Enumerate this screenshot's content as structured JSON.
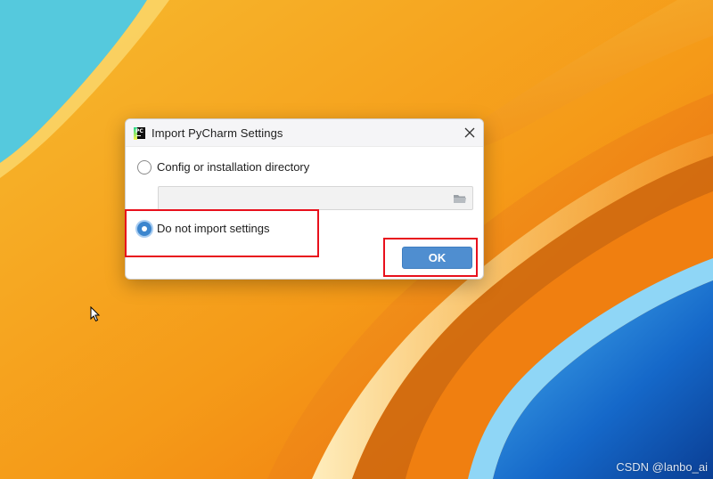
{
  "dialog": {
    "title": "Import PyCharm Settings",
    "app_icon": "pycharm-icon",
    "close_icon": "close-icon",
    "options": [
      {
        "label": "Config or installation directory",
        "selected": false
      },
      {
        "label": "Do not import settings",
        "selected": true
      }
    ],
    "path_field": {
      "value": "",
      "icon": "folder-icon"
    },
    "ok_label": "OK"
  },
  "watermark": "CSDN @lanbo_ai",
  "colors": {
    "accent": "#4f8ed0",
    "highlight_box": "#e8101c"
  }
}
